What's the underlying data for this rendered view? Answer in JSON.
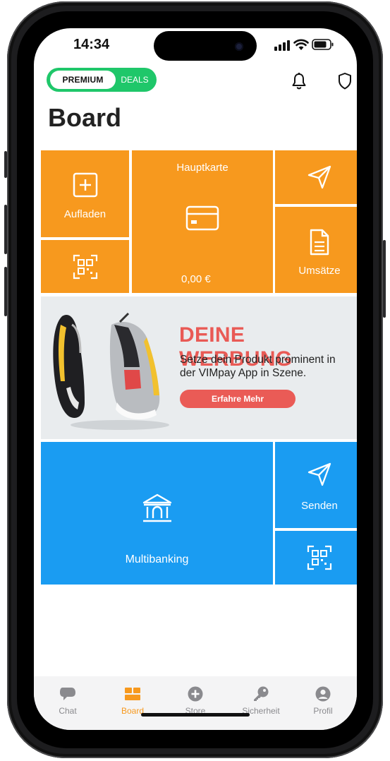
{
  "status_bar": {
    "time": "14:34"
  },
  "header": {
    "premium_label": "PREMIUM",
    "deals_label": "DEALS",
    "bell_icon": "bell-icon",
    "shield_icon": "shield-icon",
    "title": "Board"
  },
  "tiles": {
    "aufladen": {
      "label": "Aufladen",
      "icon": "plus-square-icon"
    },
    "qr_top": {
      "icon": "qr-code-icon"
    },
    "hauptkarte": {
      "title": "Hauptkarte",
      "balance": "0,00 €",
      "icon": "credit-card-icon"
    },
    "send_top": {
      "icon": "paper-plane-icon"
    },
    "umsaetze": {
      "label": "Umsätze",
      "icon": "document-icon"
    },
    "multibanking": {
      "label": "Multibanking",
      "icon": "bank-icon"
    },
    "senden": {
      "label": "Senden",
      "icon": "paper-plane-icon"
    },
    "qr_bottom": {
      "icon": "qr-code-icon"
    }
  },
  "ad": {
    "headline": "DEINE WERBUNG",
    "text": "Setze dein Produkt prominent in der VIMpay App in Szene.",
    "button": "Erfahre Mehr"
  },
  "tabbar": {
    "items": [
      {
        "label": "Chat",
        "icon": "chat-icon",
        "active": false
      },
      {
        "label": "Board",
        "icon": "board-icon",
        "active": true
      },
      {
        "label": "Store",
        "icon": "plus-circle-icon",
        "active": false
      },
      {
        "label": "Sicherheit",
        "icon": "key-icon",
        "active": false
      },
      {
        "label": "Profil",
        "icon": "profile-icon",
        "active": false
      }
    ]
  },
  "colors": {
    "orange": "#f7991e",
    "blue": "#1a9cf2",
    "green": "#1fc76a",
    "ad_red": "#e95a55"
  }
}
